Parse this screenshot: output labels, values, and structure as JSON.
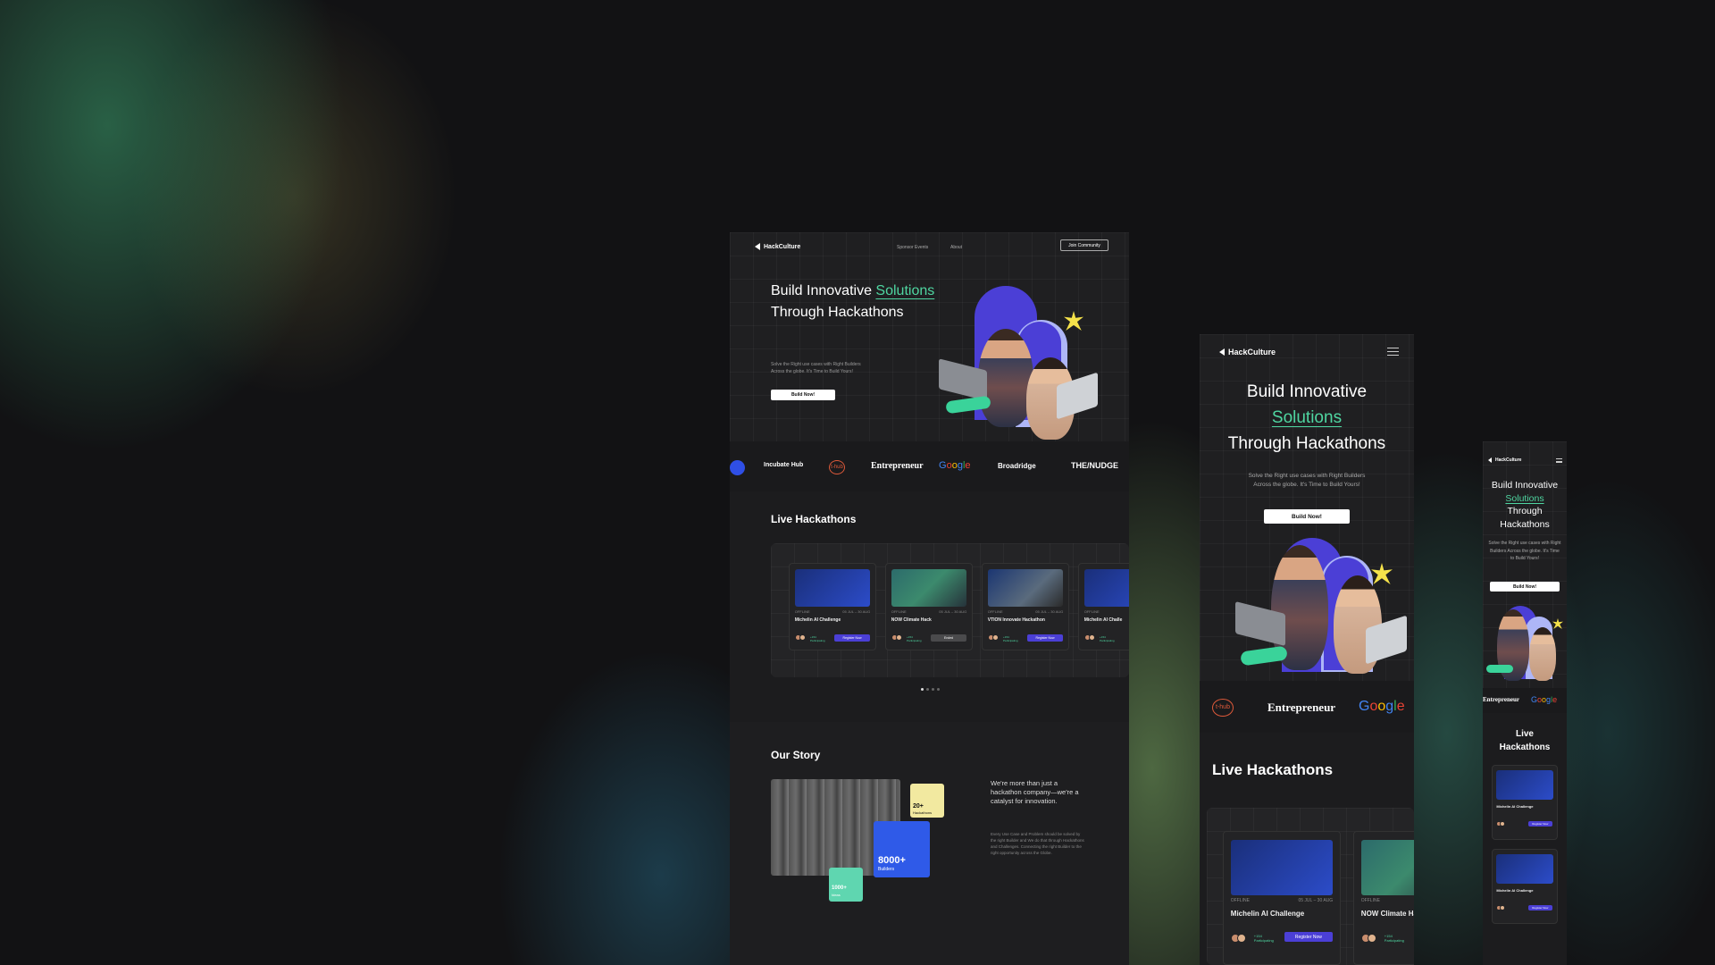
{
  "brand": {
    "name": "HackCulture"
  },
  "nav": {
    "sponsor_events": "Sponsor Events",
    "about": "About",
    "join": "Join Community"
  },
  "hero": {
    "line1": "Build Innovative",
    "accent": "Solutions",
    "line2": "Through Hackathons",
    "mobile_line1a": "Build Innovative",
    "mobile_line2a": "Through",
    "mobile_line2b": "Hackathons",
    "subtitle_1": "Solve the Right use cases with Right Builders",
    "subtitle_2": "Across the globe. It's Time to Build Yours!",
    "cta": "Build Now!"
  },
  "partners": [
    "Incubate Hub",
    "t-hub",
    "Entrepreneur",
    "Google",
    "Broadridge",
    "THE/NUDGE"
  ],
  "live": {
    "heading": "Live Hackathons",
    "mobile_heading_1": "Live",
    "mobile_heading_2": "Hackathons",
    "cards": [
      {
        "title": "Michelin AI Challenge",
        "mode": "OFFLINE",
        "dates": "05 JUL – 30 AUG",
        "participants": "+154 Participating",
        "action": "Register Now"
      },
      {
        "title": "NOW Climate Hack",
        "mode": "OFFLINE",
        "dates": "05 JUL – 30 AUG",
        "participants": "+154 Participating",
        "action": "Ended"
      },
      {
        "title": "VTION Innovate Hackathon",
        "mode": "OFFLINE",
        "dates": "05 JUL – 30 AUG",
        "participants": "+154 Participating",
        "action": "Register Now"
      },
      {
        "title": "Michelin AI Challe",
        "mode": "OFFLINE",
        "dates": "",
        "participants": "+154 Participating",
        "action": ""
      }
    ],
    "mobile_card_2_title": "NOW Climate Ha"
  },
  "story": {
    "heading": "Our Story",
    "tagline": "We're more than just a hackathon company—we're a catalyst for innovation.",
    "body": "Every Use Case and Problem should be solved by the right Builder and We do that through Hackathons and Challenges. Connecting the right Builder to the right opportunity across the Globe.",
    "stat_hackathons_value": "20+",
    "stat_hackathons_label": "Hackathons",
    "stat_builders_value": "8000+",
    "stat_builders_label": "Builders",
    "stat_ideas_value": "1000+",
    "stat_ideas_label": "Ideas"
  },
  "colors": {
    "accent_green": "#4fd6a1",
    "brand_purple": "#4b3fd6",
    "bg_dark": "#1c1c1e"
  }
}
